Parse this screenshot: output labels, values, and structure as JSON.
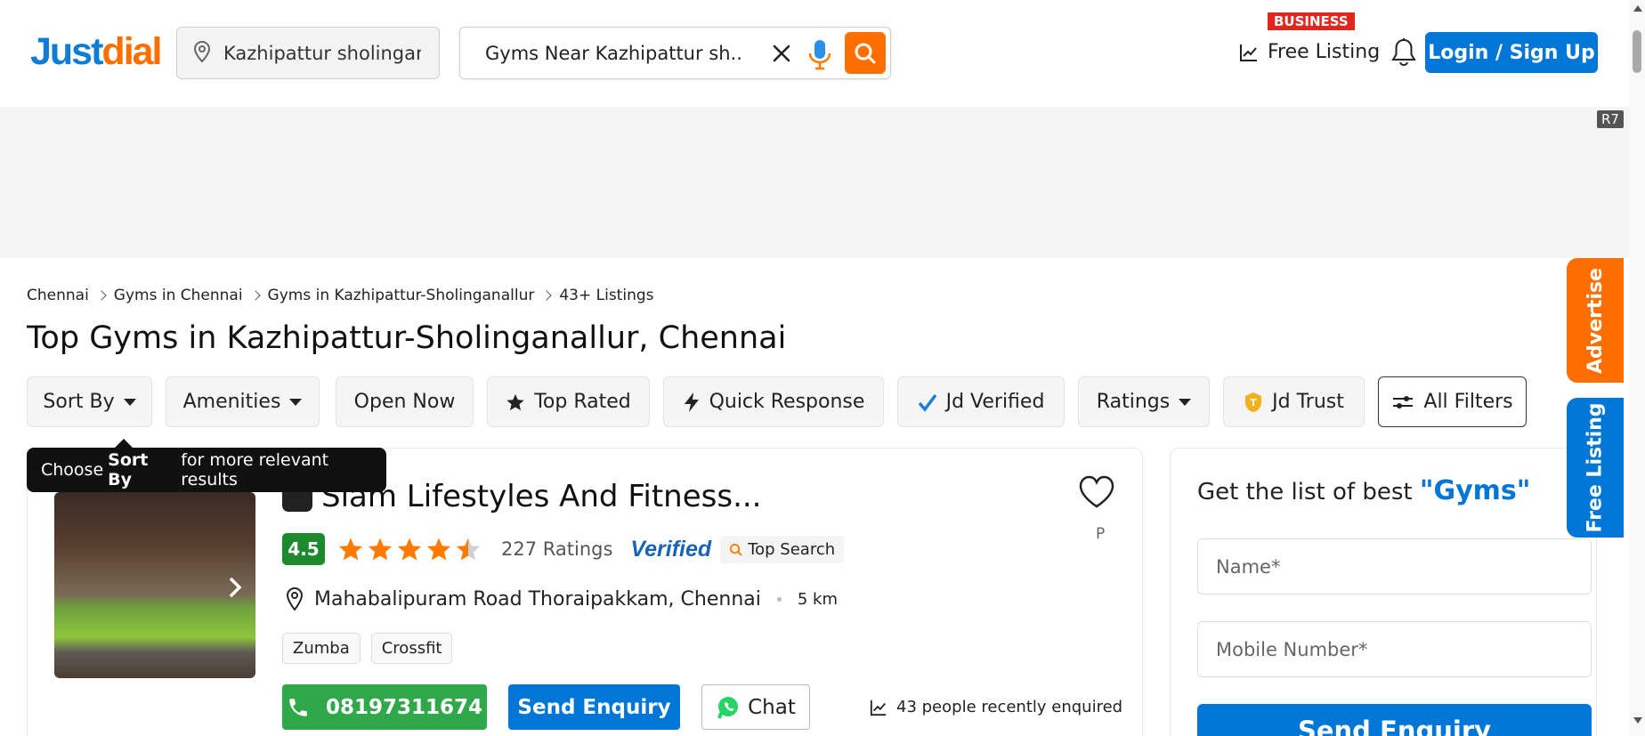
{
  "header": {
    "logo_part1": "Just",
    "logo_part2": "dial",
    "location_value": "Kazhipattur sholinganallur",
    "search_value": "Gyms Near Kazhipattur sh...",
    "business_badge": "BUSINESS",
    "free_listing": "Free Listing",
    "login_label": "Login / Sign Up"
  },
  "ad": {
    "label": "R7"
  },
  "breadcrumb": [
    "Chennai",
    "Gyms in Chennai",
    "Gyms in Kazhipattur-Sholinganallur",
    "43+ Listings"
  ],
  "page_title": "Top Gyms in Kazhipattur-Sholinganallur, Chennai",
  "filters": {
    "sort_by": "Sort By",
    "amenities": "Amenities",
    "open_now": "Open Now",
    "top_rated": "Top Rated",
    "quick_response": "Quick Response",
    "jd_verified": "Jd Verified",
    "ratings": "Ratings",
    "jd_trust": "Jd Trust",
    "all_filters": "All Filters"
  },
  "tooltip": {
    "prefix": "Choose",
    "bold": "Sort By",
    "suffix": "for more relevant results"
  },
  "listing": {
    "name": "Slam Lifestyles And Fitness...",
    "rating": "4.5",
    "rating_stars": 4.5,
    "rating_count": "227 Ratings",
    "verified": "Verified",
    "top_search": "Top Search",
    "address": "Mahabalipuram Road Thoraipakkam, Chennai",
    "distance": "5 km",
    "tags": [
      "Zumba",
      "Crossfit"
    ],
    "phone": "08197311674",
    "send_enquiry": "Send Enquiry",
    "chat": "Chat",
    "enquired": "43 people recently enquired",
    "p_label": "P"
  },
  "form": {
    "title_prefix": "Get the list of best",
    "title_highlight": "\"Gyms\"",
    "name_placeholder": "Name*",
    "mobile_placeholder": "Mobile Number*",
    "submit": "Send Enquiry"
  },
  "side_tabs": {
    "advertise": "Advertise",
    "free_listing": "Free Listing"
  },
  "colors": {
    "brand_blue": "#0076d7",
    "brand_orange": "#ff6e00",
    "green": "#2fa84a",
    "star": "#ff7a00"
  }
}
